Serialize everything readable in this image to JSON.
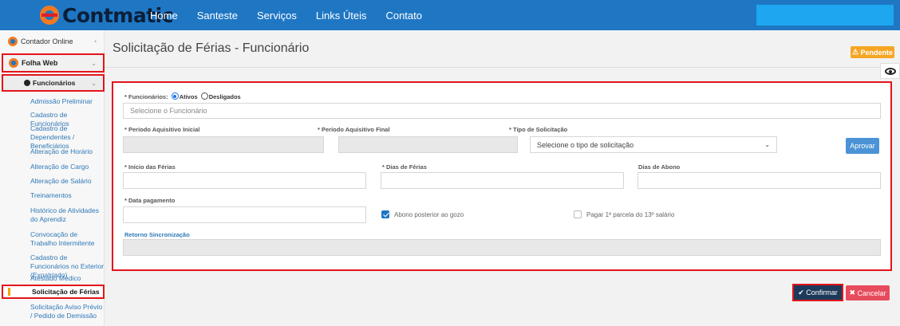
{
  "brand": {
    "name": "Contmatic"
  },
  "nav": {
    "items": [
      "Home",
      "Santeste",
      "Serviços",
      "Links Úteis",
      "Contato"
    ]
  },
  "sidebar": {
    "root": "Contador Online",
    "folha": "Folha Web",
    "funcionarios": "Funcionários",
    "items": [
      "Admissão Preliminar",
      "Cadastro de Funcionários",
      "Cadastro de Dependentes / Beneficiários",
      "Alteração de Horário",
      "Alteração de Cargo",
      "Alteração de Salário",
      "Treinamentos",
      "Histórico de Atividades do Aprendiz",
      "Convocação de Trabalho Intermitente",
      "Cadastro de Funcionários no Exterior (Expatriado)",
      "Atestado Médico"
    ],
    "active": "Solicitação de Férias",
    "after": "Solicitação Aviso Prévio / Pedido de Demissão"
  },
  "page": {
    "title": "Solicitação de Férias - Funcionário",
    "status": "Pendente"
  },
  "form": {
    "funcionarios_label": "* Funcionários:",
    "opt_ativos": "Ativos",
    "opt_desligados": "Desligados",
    "func_placeholder": "Selecione o Funcionário",
    "periodo_inicial_label": "* Período Aquisitivo Inicial",
    "periodo_final_label": "* Período Aquisitivo Final",
    "tipo_label": "* Tipo de Solicitação",
    "tipo_value": "Selecione o tipo de solicitação",
    "aprovar": "Aprovar",
    "inicio_label": "* Início das Férias",
    "dias_label": "* Dias de Férias",
    "abono_label": "Dias de Abono",
    "pagamento_label": "* Data pagamento",
    "abono_posterior": "Abono posterior ao gozo",
    "abono_posterior_checked": true,
    "pagar_13": "Pagar 1ª parcela do 13º salário",
    "pagar_13_checked": false,
    "retorno_label": "Retorno Sincronização"
  },
  "actions": {
    "confirm": "Confirmar",
    "cancel": "Cancelar"
  }
}
